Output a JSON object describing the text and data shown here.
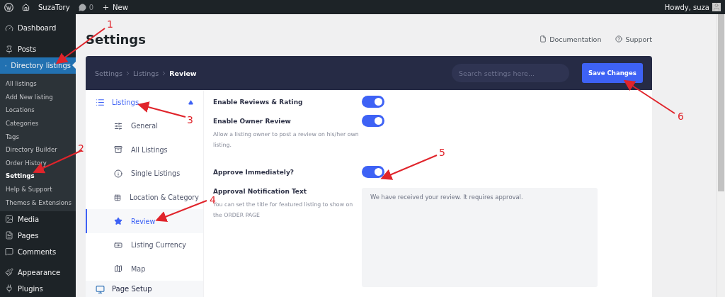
{
  "admin_bar": {
    "site": "SuzaTory",
    "comments": "0",
    "new": "New",
    "greeting": "Howdy, suza"
  },
  "sidebar": {
    "items": [
      {
        "label": "Dashboard",
        "selected": false
      },
      {
        "label": "Posts",
        "selected": false
      },
      {
        "label": "Directory listings",
        "selected": true,
        "children": [
          {
            "label": "All listings",
            "selected": false
          },
          {
            "label": "Add New listing",
            "selected": false
          },
          {
            "label": "Locations",
            "selected": false
          },
          {
            "label": "Categories",
            "selected": false
          },
          {
            "label": "Tags",
            "selected": false
          },
          {
            "label": "Directory Builder",
            "selected": false
          },
          {
            "label": "Order History",
            "selected": false
          },
          {
            "label": "Settings",
            "selected": true
          },
          {
            "label": "Help & Support",
            "selected": false
          },
          {
            "label": "Themes & Extensions",
            "selected": false
          }
        ]
      },
      {
        "label": "Media",
        "selected": false
      },
      {
        "label": "Pages",
        "selected": false
      },
      {
        "label": "Comments",
        "selected": false
      },
      {
        "label": "Appearance",
        "selected": false
      },
      {
        "label": "Plugins",
        "selected": false
      }
    ]
  },
  "page": {
    "title": "Settings",
    "links": [
      "Documentation",
      "Support"
    ]
  },
  "header": {
    "breadcrumb": [
      "Settings",
      "Listings",
      "Review"
    ],
    "search": {
      "placeholder": "Search settings here..."
    },
    "save_button": "Save Changes"
  },
  "settings_nav": {
    "group": {
      "label": "Listings",
      "expanded": true,
      "children": [
        {
          "label": "General",
          "selected": false
        },
        {
          "label": "All Listings",
          "selected": false
        },
        {
          "label": "Single Listings",
          "selected": false
        },
        {
          "label": "Location & Category",
          "selected": false
        },
        {
          "label": "Review",
          "selected": true
        },
        {
          "label": "Listing Currency",
          "selected": false
        },
        {
          "label": "Map",
          "selected": false
        }
      ]
    },
    "next_group": "Page Setup"
  },
  "fields": [
    {
      "kind": "toggle",
      "label": "Enable Reviews & Rating",
      "on": true
    },
    {
      "kind": "toggle",
      "label": "Enable Owner Review",
      "description": "Allow a listing owner to post a review on his/her own listing.",
      "on": true
    },
    {
      "kind": "toggle",
      "label": "Approve Immediately?",
      "on": true
    },
    {
      "kind": "textarea",
      "label": "Approval Notification Text",
      "description": "You can set the title for featured listing to show on the ORDER PAGE",
      "value": "We have received your review. It requires approval."
    }
  ],
  "callouts": [
    {
      "label": "1"
    },
    {
      "label": "2"
    },
    {
      "label": "3"
    },
    {
      "label": "4"
    },
    {
      "label": "5"
    },
    {
      "label": "6"
    }
  ]
}
